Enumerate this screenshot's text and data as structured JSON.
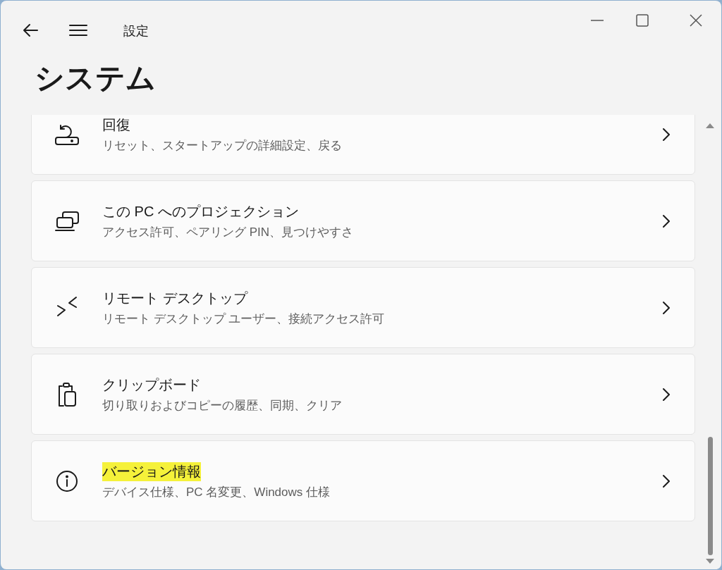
{
  "window": {
    "app_title": "設定"
  },
  "page_title": "システム",
  "items": [
    {
      "kind": "recovery",
      "title": "回復",
      "subtitle": "リセット、スタートアップの詳細設定、戻る",
      "highlighted": false
    },
    {
      "kind": "projection",
      "title": "この PC へのプロジェクション",
      "subtitle": "アクセス許可、ペアリング PIN、見つけやすさ",
      "highlighted": false
    },
    {
      "kind": "remote",
      "title": "リモート デスクトップ",
      "subtitle": "リモート デスクトップ ユーザー、接続アクセス許可",
      "highlighted": false
    },
    {
      "kind": "clipboard",
      "title": "クリップボード",
      "subtitle": "切り取りおよびコピーの履歴、同期、クリア",
      "highlighted": false
    },
    {
      "kind": "info",
      "title": "バージョン情報",
      "subtitle": "デバイス仕様、PC 名変更、Windows 仕様",
      "highlighted": true
    }
  ]
}
